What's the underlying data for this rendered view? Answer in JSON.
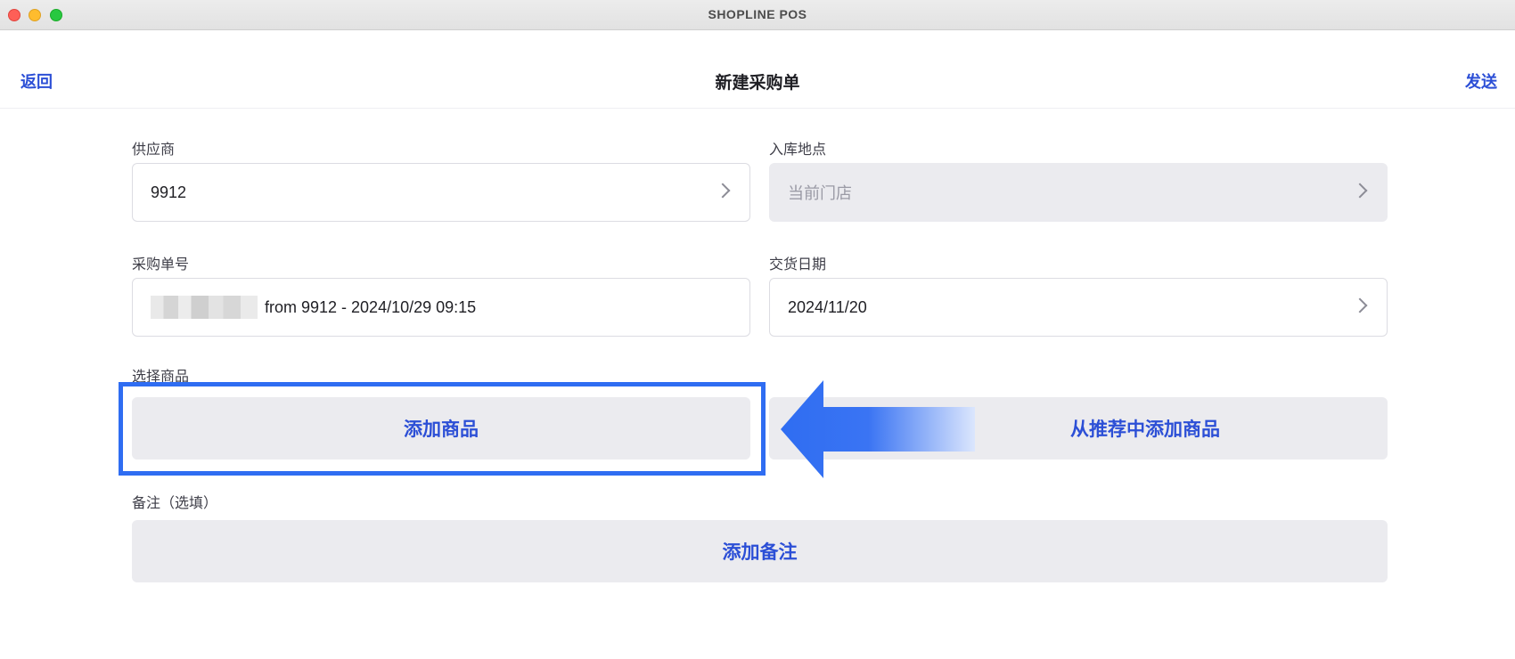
{
  "window": {
    "title": "SHOPLINE POS"
  },
  "nav": {
    "back_label": "返回",
    "title": "新建采购单",
    "send_label": "发送"
  },
  "form": {
    "supplier": {
      "label": "供应商",
      "value": "9912"
    },
    "location": {
      "label": "入库地点",
      "value": "当前门店"
    },
    "po_number": {
      "label": "采购单号",
      "value": "from 9912 - 2024/10/29 09:15"
    },
    "delivery_date": {
      "label": "交货日期",
      "value": "2024/11/20"
    },
    "products": {
      "label": "选择商品",
      "add_button": "添加商品",
      "recommend_button": "从推荐中添加商品"
    },
    "notes": {
      "label": "备注（选填）",
      "add_button": "添加备注"
    }
  },
  "colors": {
    "accent": "#2c4fd6",
    "highlight": "#2f6df2",
    "button_bg": "#ebebef"
  },
  "icons": [
    "chevron-right-icon",
    "left-arrow-annotation-icon"
  ]
}
